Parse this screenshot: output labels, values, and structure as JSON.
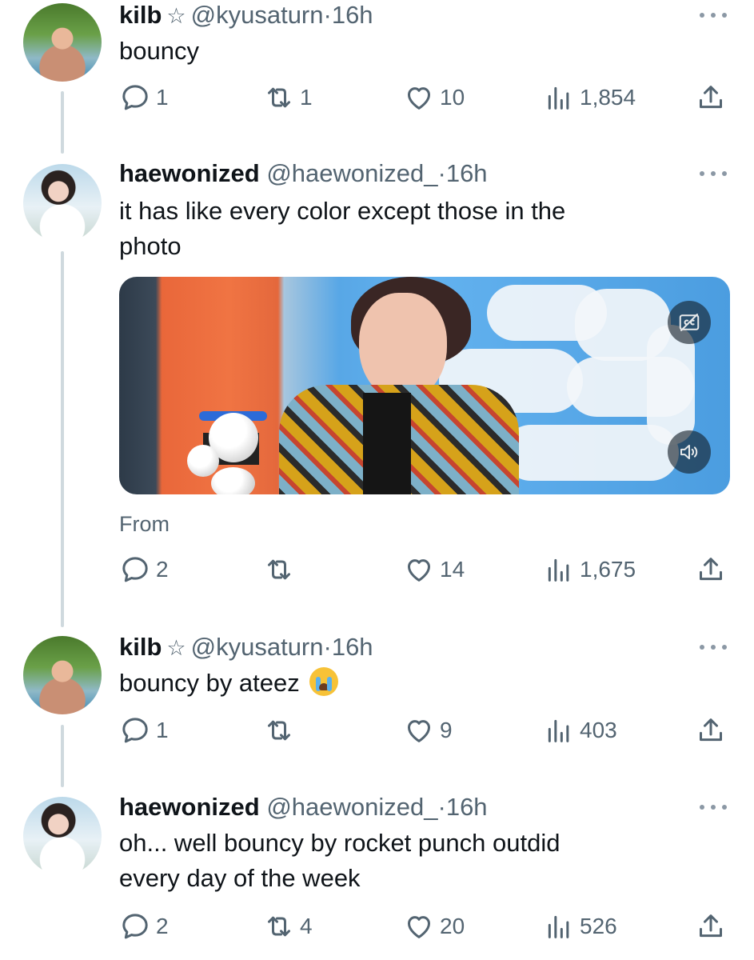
{
  "tweets": [
    {
      "name": "kilb",
      "star": "☆",
      "handle": "@kyusaturn",
      "sep": "·",
      "time": "16h",
      "text": "bouncy",
      "replies": "1",
      "retweets": "1",
      "likes": "10",
      "views": "1,854"
    },
    {
      "name": "haewonized",
      "handle": "@haewonized_",
      "sep": "·",
      "time": "16h",
      "text_line1": "it has like every color except those in the",
      "text_line2": "photo",
      "from_label": "From",
      "replies": "2",
      "retweets": "",
      "likes": "14",
      "views": "1,675"
    },
    {
      "name": "kilb",
      "star": "☆",
      "handle": "@kyusaturn",
      "sep": "·",
      "time": "16h",
      "text": "bouncy by ateez",
      "replies": "1",
      "retweets": "",
      "likes": "9",
      "views": "403"
    },
    {
      "name": "haewonized",
      "handle": "@haewonized_",
      "sep": "·",
      "time": "16h",
      "text_line1": "oh... well bouncy by rocket punch outdid",
      "text_line2": "every day of the week",
      "replies": "2",
      "retweets": "4",
      "likes": "20",
      "views": "526"
    }
  ],
  "icons": {
    "reply": "reply-icon",
    "retweet": "retweet-icon",
    "like": "heart-icon",
    "views": "views-icon",
    "share": "share-icon",
    "more": "more-icon",
    "captions": "captions-icon",
    "volume": "volume-icon"
  },
  "colors": {
    "text": "#0f1419",
    "secondary": "#536471",
    "thread_line": "#cfd9de"
  }
}
